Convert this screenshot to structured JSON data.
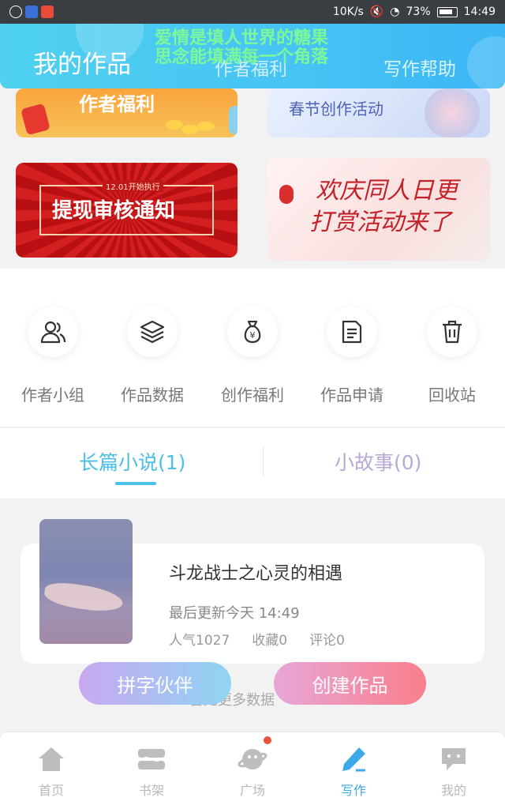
{
  "status_bar": {
    "network_speed": "10K/s",
    "battery": "73%",
    "time": "14:49"
  },
  "header": {
    "title": "我的作品",
    "tab_welfare": "作者福利",
    "help": "写作帮助",
    "slogan_line1": "爱情是填人世界的糖果",
    "slogan_line2": "思念能填满每一个角落"
  },
  "banners": {
    "welfare_title": "作者福利",
    "spring_title": "春节创作活动",
    "withdraw_title": "提现审核通知",
    "withdraw_small": "12.01开始执行",
    "celebrate_line1": "欢庆同人日更",
    "celebrate_line2": "打赏活动来了"
  },
  "quick_menu": {
    "items": [
      {
        "label": "作者小组",
        "icon": "people-icon"
      },
      {
        "label": "作品数据",
        "icon": "layers-icon"
      },
      {
        "label": "创作福利",
        "icon": "money-bag-icon"
      },
      {
        "label": "作品申请",
        "icon": "document-icon"
      },
      {
        "label": "回收站",
        "icon": "trash-icon"
      }
    ]
  },
  "tabs": {
    "novel": "长篇小说(1)",
    "story": "小故事(0)"
  },
  "book": {
    "title": "斗龙战士之心灵的相遇",
    "updated": "最后更新今天 14:49",
    "popularity": "人气1027",
    "favorites": "收藏0",
    "comments": "评论0"
  },
  "no_more": "暂无更多数据",
  "buttons": {
    "partner": "拼字伙伴",
    "create": "创建作品"
  },
  "bottom_nav": {
    "items": [
      {
        "label": "首页",
        "icon": "home-icon"
      },
      {
        "label": "书架",
        "icon": "bookshelf-icon"
      },
      {
        "label": "广场",
        "icon": "planet-icon"
      },
      {
        "label": "写作",
        "icon": "pen-icon"
      },
      {
        "label": "我的",
        "icon": "chat-bubble-icon"
      }
    ]
  },
  "colors": {
    "header_gradient_start": "#4fd1ef",
    "accent_blue": "#4bbfe6",
    "create_button_end": "#f87f8c"
  }
}
